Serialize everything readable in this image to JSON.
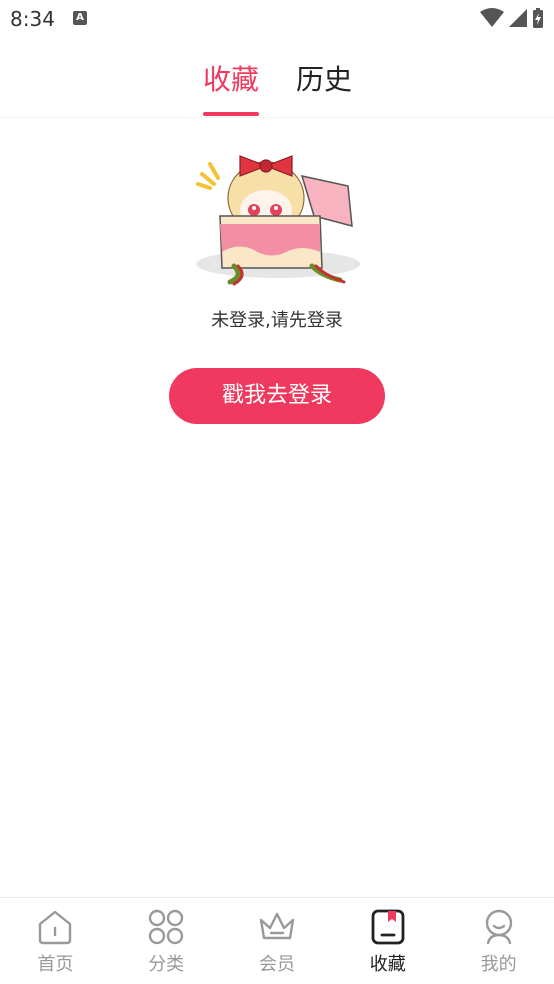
{
  "status_bar": {
    "time": "8:34",
    "notification_letter": "A"
  },
  "tabs": [
    {
      "label": "收藏",
      "active": true
    },
    {
      "label": "历史",
      "active": false
    }
  ],
  "empty_state": {
    "message": "未登录,请先登录",
    "button_label": "戳我去登录"
  },
  "bottom_nav": [
    {
      "label": "首页",
      "icon": "home-icon",
      "active": false
    },
    {
      "label": "分类",
      "icon": "category-icon",
      "active": false
    },
    {
      "label": "会员",
      "icon": "crown-icon",
      "active": false
    },
    {
      "label": "收藏",
      "icon": "bookmark-icon",
      "active": true
    },
    {
      "label": "我的",
      "icon": "profile-icon",
      "active": false
    }
  ],
  "colors": {
    "accent": "#f0395e",
    "inactive": "#999999",
    "active_text": "#222222"
  }
}
